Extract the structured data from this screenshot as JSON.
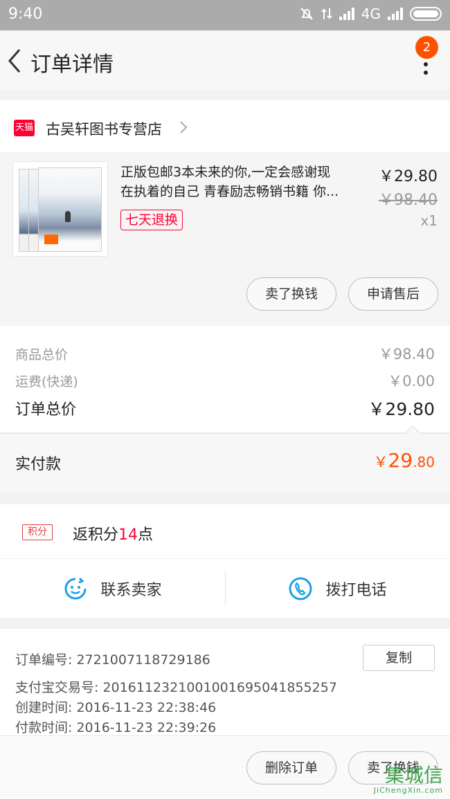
{
  "status_bar": {
    "time": "9:40",
    "network": "4G"
  },
  "nav": {
    "title": "订单详情",
    "badge": "2"
  },
  "shop": {
    "badge_text": "天猫",
    "name": "古吴轩图书专营店"
  },
  "item": {
    "title_line1": "正版包邮3本未来的你,一定会感谢现",
    "title_line2": "在执着的自己 青春励志畅销书籍 你...",
    "tag": "七天退换",
    "price": "￥29.80",
    "original_price": "￥98.40",
    "quantity": "x1",
    "actions": [
      "卖了换钱",
      "申请售后"
    ]
  },
  "summary": {
    "goods_label": "商品总价",
    "goods_value": "￥98.40",
    "shipping_label": "运费(快递)",
    "shipping_value": "￥0.00",
    "total_label": "订单总价",
    "total_value": "￥29.80"
  },
  "paid": {
    "label": "实付款",
    "currency": "￥",
    "integer": "29",
    "decimal": ".80"
  },
  "points": {
    "tag": "积分",
    "prefix": "返积分",
    "number": "14",
    "suffix": "点"
  },
  "contact": {
    "seller_label": "联系卖家",
    "phone_label": "拨打电话"
  },
  "order_info": {
    "order_no": "订单编号:   2721007118729186",
    "copy_label": "复制",
    "alipay_no": "支付宝交易号:   2016112321001001695041855257",
    "created": "创建时间:   2016-11-23 22:38:46",
    "paid_time": "付款时间:   2016-11-23 22:39:26"
  },
  "footer": {
    "actions": [
      "删除订单",
      "卖了换钱"
    ]
  },
  "watermark": {
    "logo": "集城信",
    "url": "JiChengXin.com"
  },
  "colors": {
    "accent": "#ff5000",
    "tmall": "#ff0036"
  }
}
